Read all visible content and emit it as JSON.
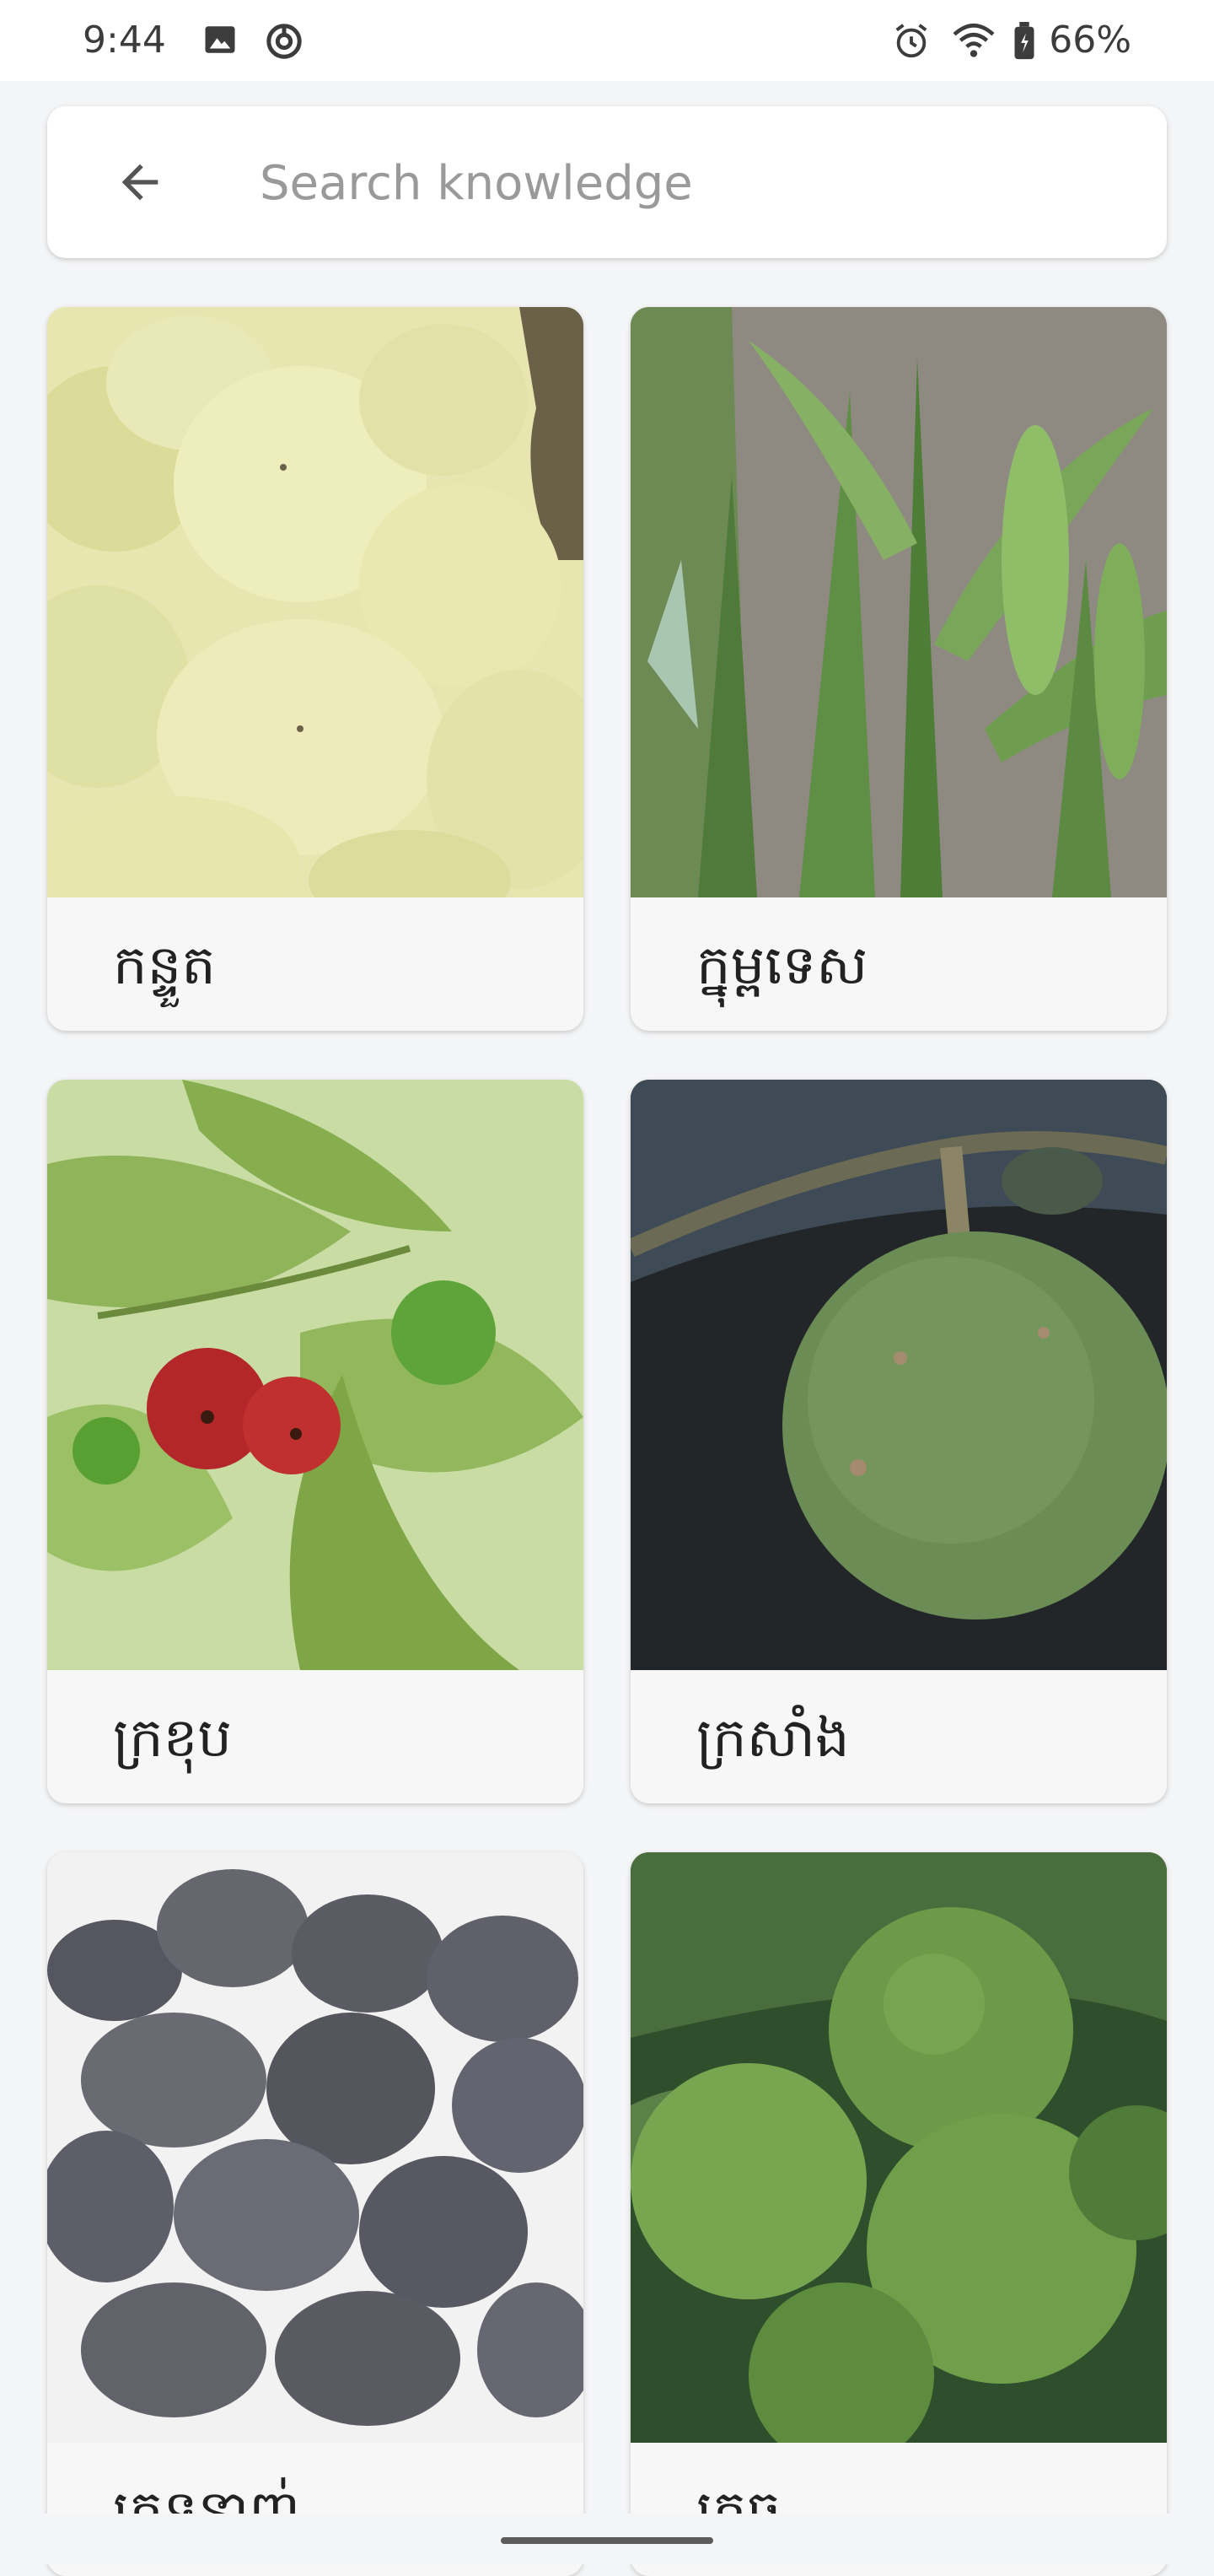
{
  "status_bar": {
    "time": "9:44",
    "battery_percent": "66%",
    "icons": [
      "image-icon",
      "vpn-icon",
      "alarm-icon",
      "wifi-icon",
      "battery-icon"
    ]
  },
  "search": {
    "placeholder": "Search knowledge",
    "value": ""
  },
  "items": [
    {
      "label": "កន្ទួត",
      "image": "star-gooseberry-image"
    },
    {
      "label": "ក្នុម្ពទេស",
      "image": "legume-plant-image"
    },
    {
      "label": "ក្រខុប",
      "image": "red-berries-image"
    },
    {
      "label": "ក្រសាំង",
      "image": "wood-apple-image"
    },
    {
      "label": "ក្រទន្លាញ់",
      "image": "dark-plums-image"
    },
    {
      "label": "ក្រូច",
      "image": "green-oranges-image"
    }
  ],
  "colors": {
    "background": "#f4f5f6",
    "card": "#f7f7f7",
    "text": "#222222",
    "placeholder": "#9a9a9a"
  }
}
